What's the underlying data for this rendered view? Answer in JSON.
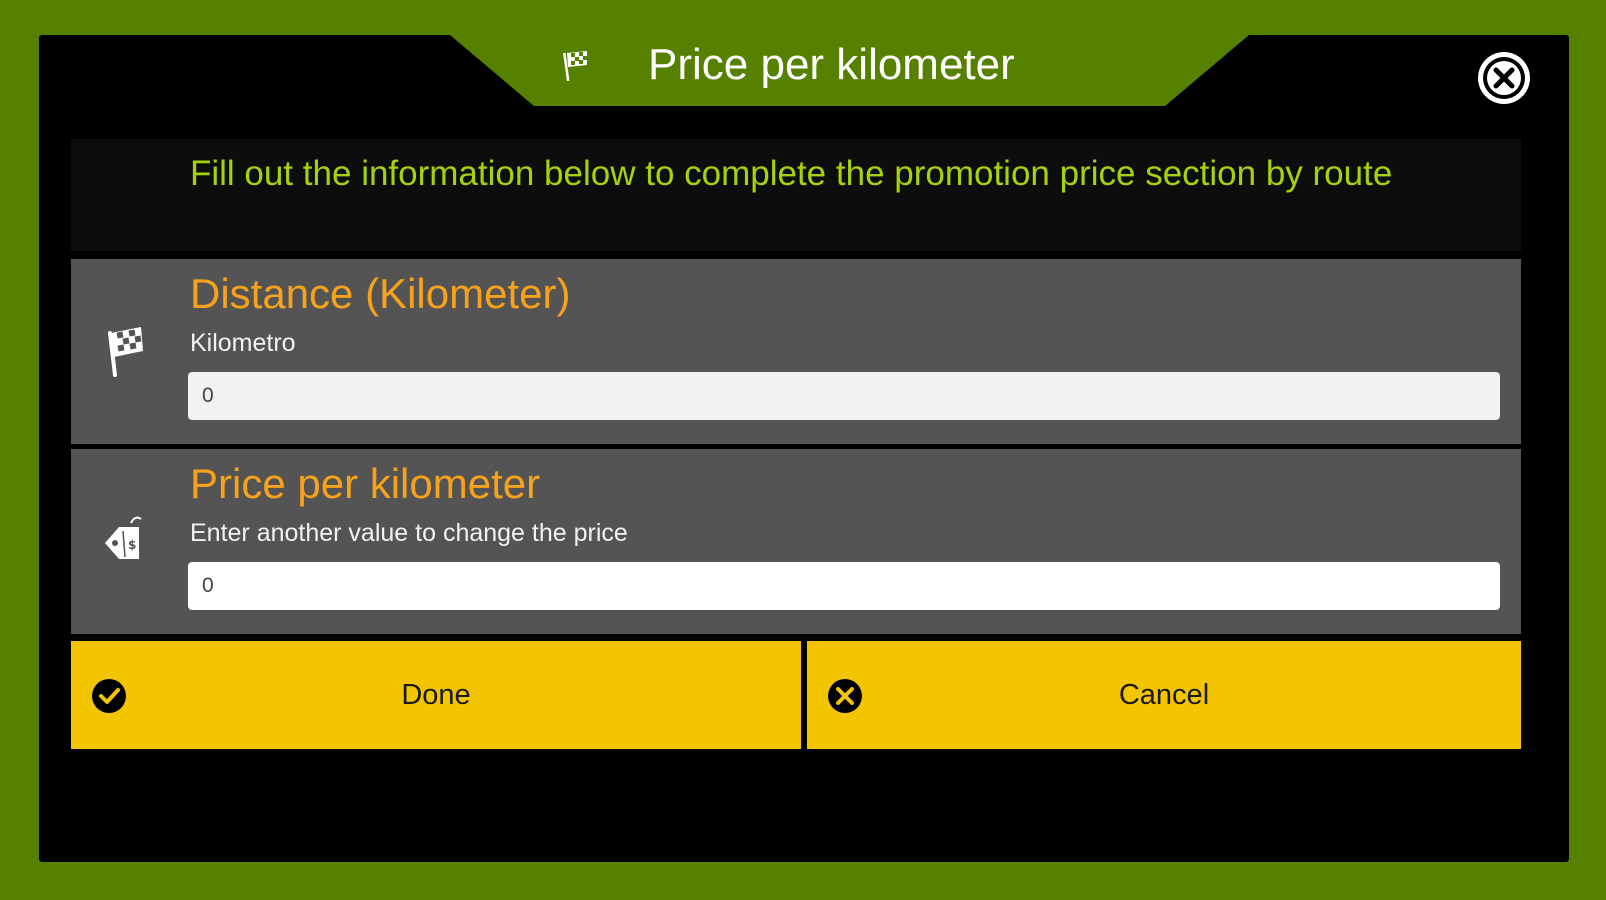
{
  "dialog": {
    "title": "Price per kilometer",
    "title_icon": "checkered-flag-icon",
    "close_icon": "close-icon",
    "info_text": "Fill out the information below to complete the promotion price section by route"
  },
  "fields": [
    {
      "title": "Distance (Kilometer)",
      "subtitle": "Kilometro",
      "icon": "checkered-flag-icon",
      "value": "0"
    },
    {
      "title": "Price per kilometer",
      "subtitle": "Enter another value to change the price",
      "icon": "price-tag-icon",
      "value": "0"
    }
  ],
  "buttons": {
    "done_label": "Done",
    "done_icon": "check-circle-icon",
    "cancel_label": "Cancel",
    "cancel_icon": "x-circle-icon"
  },
  "colors": {
    "background": "#568000",
    "modal": "#000000",
    "info_text": "#a6d20a",
    "field_title": "#f7a21b",
    "section": "#545454",
    "button": "#f2c500"
  }
}
